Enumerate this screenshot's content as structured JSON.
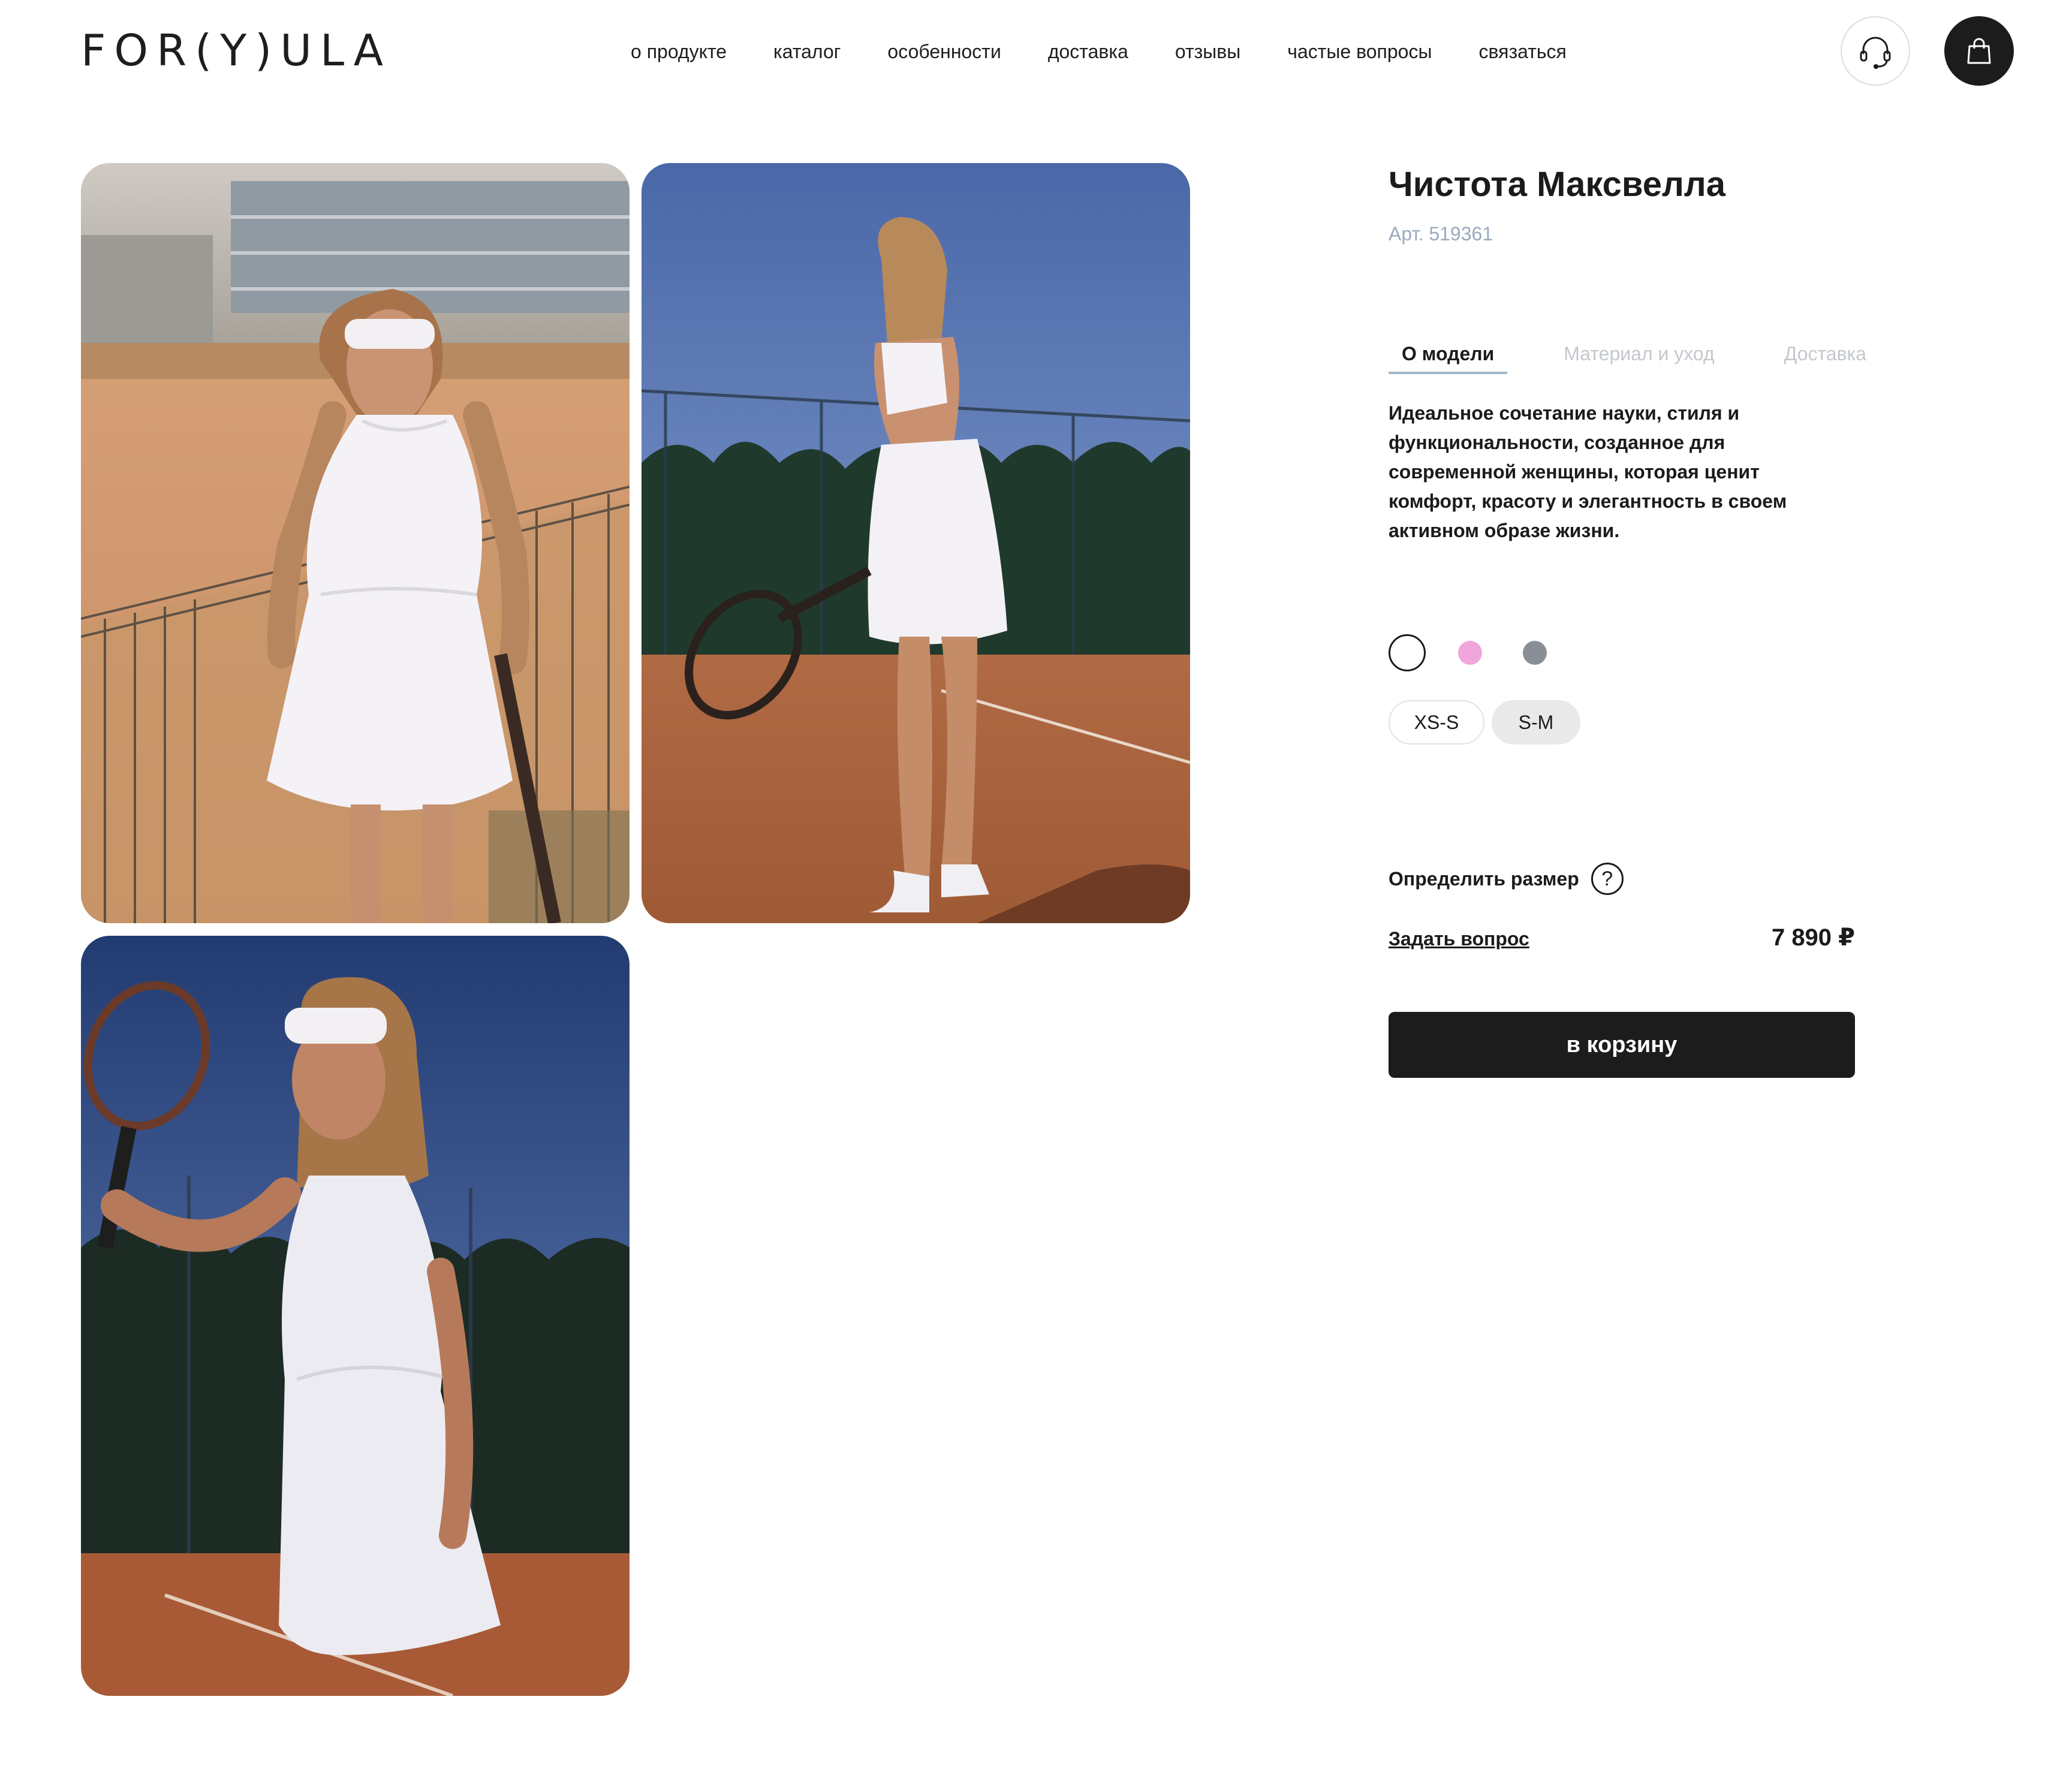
{
  "header": {
    "logo": "FOR(Y)ULA",
    "nav": [
      "о продукте",
      "каталог",
      "особенности",
      "доставка",
      "отзывы",
      "частые вопросы",
      "связаться"
    ],
    "icons": [
      "headset-icon",
      "shopping-bag-icon"
    ]
  },
  "gallery": {
    "photos": [
      "tennis-dress-front-photo",
      "tennis-dress-back-photo",
      "tennis-dress-action-photo"
    ]
  },
  "product": {
    "title": "Чистота Максвелла",
    "sku": "Арт. 519361",
    "tabs": [
      "О модели",
      "Материал и уход",
      "Доставка"
    ],
    "active_tab": "О модели",
    "description": "Идеальное сочетание науки, стиля и функциональности, созданное для современной женщины, которая ценит комфорт, красоту и элегантность в своем активном образе жизни.",
    "colors": [
      "#ffffff",
      "#f0a6da",
      "#8a8f96"
    ],
    "selected_color": "#ffffff",
    "sizes": [
      "XS-S",
      "S-M"
    ],
    "selected_size": "S-M",
    "size_help_label": "Определить размер",
    "size_help_icon": "?",
    "ask_label": "Задать вопрос",
    "price": "7 890 ₽",
    "add_to_cart": "в корзину"
  }
}
